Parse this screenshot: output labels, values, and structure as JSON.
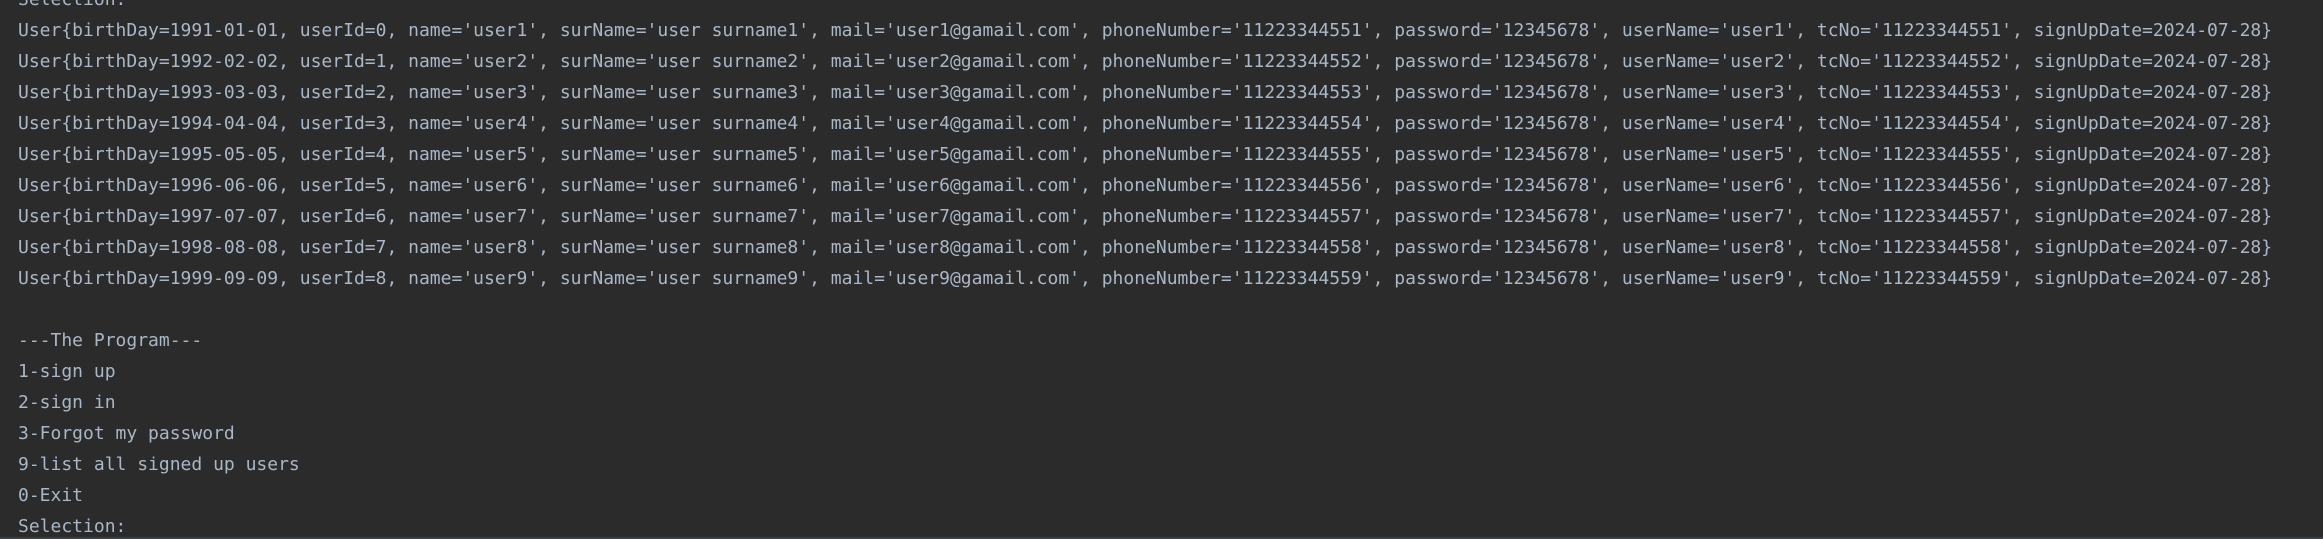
{
  "console": {
    "cut_top_line": "Selection:",
    "user_lines": [
      "User{birthDay=1991-01-01, userId=0, name='user1', surName='user surname1', mail='user1@gamail.com', phoneNumber='11223344551', password='12345678', userName='user1', tcNo='11223344551', signUpDate=2024-07-28}",
      "User{birthDay=1992-02-02, userId=1, name='user2', surName='user surname2', mail='user2@gamail.com', phoneNumber='11223344552', password='12345678', userName='user2', tcNo='11223344552', signUpDate=2024-07-28}",
      "User{birthDay=1993-03-03, userId=2, name='user3', surName='user surname3', mail='user3@gamail.com', phoneNumber='11223344553', password='12345678', userName='user3', tcNo='11223344553', signUpDate=2024-07-28}",
      "User{birthDay=1994-04-04, userId=3, name='user4', surName='user surname4', mail='user4@gamail.com', phoneNumber='11223344554', password='12345678', userName='user4', tcNo='11223344554', signUpDate=2024-07-28}",
      "User{birthDay=1995-05-05, userId=4, name='user5', surName='user surname5', mail='user5@gamail.com', phoneNumber='11223344555', password='12345678', userName='user5', tcNo='11223344555', signUpDate=2024-07-28}",
      "User{birthDay=1996-06-06, userId=5, name='user6', surName='user surname6', mail='user6@gamail.com', phoneNumber='11223344556', password='12345678', userName='user6', tcNo='11223344556', signUpDate=2024-07-28}",
      "User{birthDay=1997-07-07, userId=6, name='user7', surName='user surname7', mail='user7@gamail.com', phoneNumber='11223344557', password='12345678', userName='user7', tcNo='11223344557', signUpDate=2024-07-28}",
      "User{birthDay=1998-08-08, userId=7, name='user8', surName='user surname8', mail='user8@gamail.com', phoneNumber='11223344558', password='12345678', userName='user8', tcNo='11223344558', signUpDate=2024-07-28}",
      "User{birthDay=1999-09-09, userId=8, name='user9', surName='user surname9', mail='user9@gamail.com', phoneNumber='11223344559', password='12345678', userName='user9', tcNo='11223344559', signUpDate=2024-07-28}"
    ],
    "menu": {
      "title": "---The Program---",
      "options": [
        "1-sign up",
        "2-sign in",
        "3-Forgot my password",
        "9-list all signed up users",
        "0-Exit"
      ],
      "prompt": "Selection:"
    },
    "colors": {
      "background": "#2b2b2b",
      "text": "#a9b7c6"
    }
  }
}
